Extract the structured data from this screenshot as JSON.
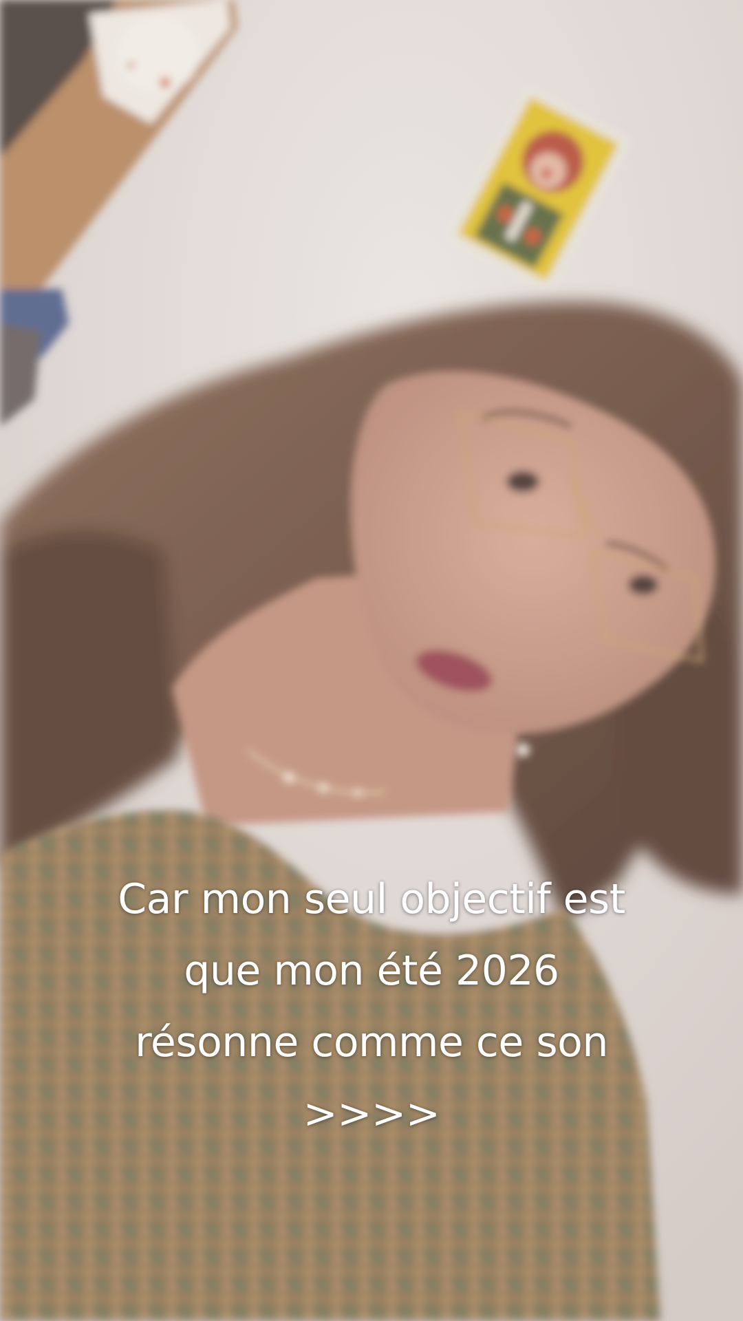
{
  "caption": {
    "line1": "Car mon seul objectif est",
    "line2": "que mon été 2026",
    "line3": "résonne comme ce son",
    "line4": ">>>>"
  },
  "colors": {
    "wall": "#e2dcd8",
    "hair": "#6e5444",
    "skin": "#c99a88",
    "lips": "#9a4a52",
    "sweater": "#8a7656",
    "shelf": "#b88a62",
    "caption_text": "#ffffff"
  }
}
